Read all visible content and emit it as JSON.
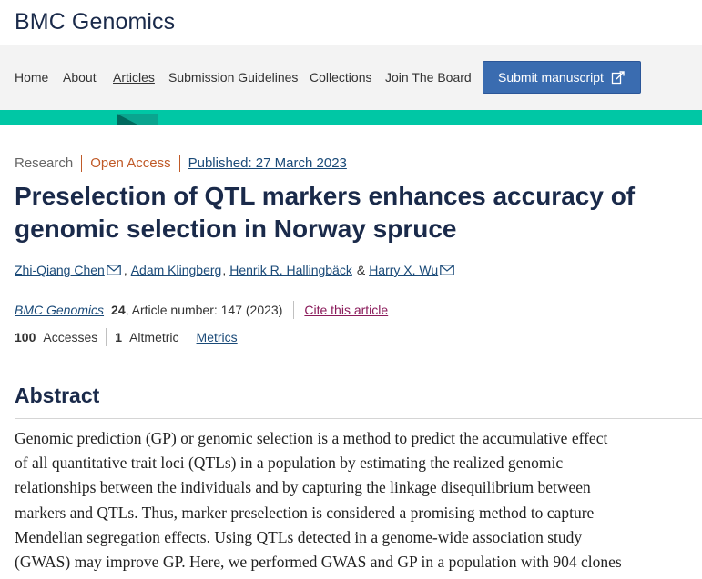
{
  "header": {
    "journal_title": "BMC Genomics"
  },
  "nav": {
    "items": [
      {
        "label": "Home"
      },
      {
        "label": "About"
      },
      {
        "label": "Articles"
      },
      {
        "label": "Submission Guidelines"
      },
      {
        "label": "Collections"
      },
      {
        "label": "Join The Board"
      }
    ],
    "active_item": "Articles",
    "submit_label": "Submit manuscript",
    "submit_icon": "external-link-icon"
  },
  "colors": {
    "accent": "#00c7a5",
    "brand_button": "#3a6cb0",
    "open_access": "#c05a28",
    "link": "#1a4a78"
  },
  "article": {
    "type": "Research",
    "access": "Open Access",
    "published": "Published: 27 March 2023",
    "title": "Preselection of QTL markers enhances accuracy of genomic selection in Norway spruce",
    "authors": [
      {
        "name": "Zhi-Qiang Chen",
        "email_icon": true
      },
      {
        "name": "Adam Klingberg",
        "email_icon": false
      },
      {
        "name": "Henrik R. Hallingbäck",
        "email_icon": false
      },
      {
        "name": "Harry X. Wu",
        "email_icon": true
      }
    ],
    "author_separators": [
      ",",
      ",",
      "&"
    ],
    "citation": {
      "journal": "BMC Genomics",
      "volume": "24",
      "rest": ", Article number: 147 (2023)",
      "cite_label": "Cite this article"
    },
    "metrics": {
      "accesses_count": "100",
      "accesses_label": "Accesses",
      "altmetric_count": "1",
      "altmetric_label": "Altmetric",
      "metrics_link": "Metrics"
    }
  },
  "abstract": {
    "heading": "Abstract",
    "lines": [
      "Genomic prediction (GP) or genomic selection is a method to predict the accumulative effect",
      "of all quantitative trait loci (QTLs) in a population by estimating the realized genomic",
      "relationships between the individuals and by capturing the linkage disequilibrium between",
      "markers and QTLs. Thus, marker preselection is considered a promising method to capture",
      "Mendelian segregation effects. Using QTLs detected in a genome-wide association study",
      "(GWAS) may improve GP. Here, we performed GWAS and GP in a population with 904 clones"
    ]
  }
}
